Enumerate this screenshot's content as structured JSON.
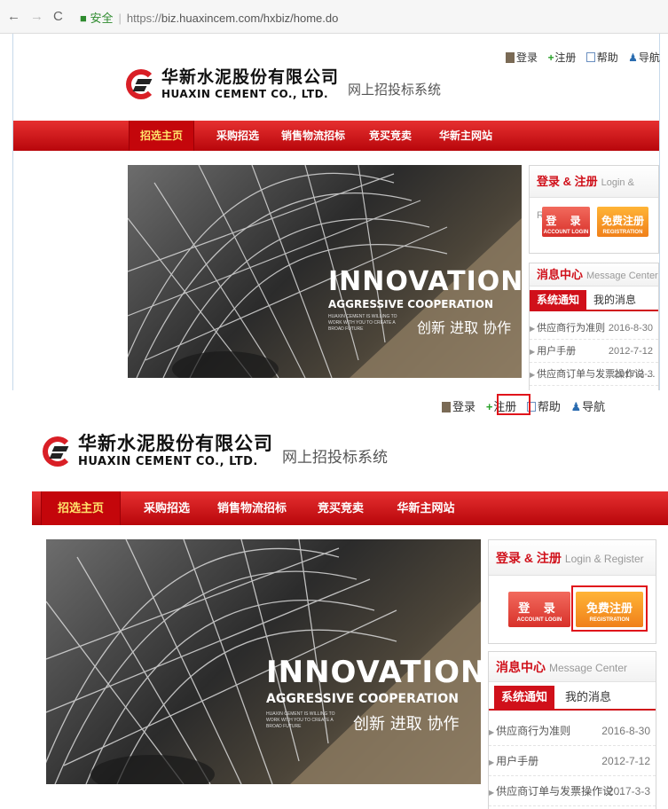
{
  "browser": {
    "back": "←",
    "forward": "→",
    "reload": "C",
    "secure_label": "安全",
    "url_scheme": "https://",
    "url_rest": "biz.huaxincem.com/hxbiz/home.do"
  },
  "header": {
    "utility": {
      "login": "登录",
      "register": "注册",
      "help": "帮助",
      "nav": "导航"
    },
    "logo_cn": "华新水泥股份有限公司",
    "logo_en": "HUAXIN CEMENT CO., LTD.",
    "system_name": "网上招投标系统"
  },
  "nav": {
    "items": [
      "招选主页",
      "采购招选",
      "销售物流招标",
      "竞买竞卖",
      "华新主网站"
    ]
  },
  "banner": {
    "title": "INNOVATION",
    "subtitle": "AGGRESSIVE COOPERATION",
    "small_text": "HUAXIN CEMENT IS WILLING TO\nWORK WITH YOU TO CREATE A\nBROAD FUTURE",
    "slogan_cn": "创新 进取 协作"
  },
  "login_box": {
    "title_cn": "登录 & 注册",
    "title_en": "Login & Register",
    "login_label": "登 录",
    "login_sub": "ACCOUNT LOGIN",
    "register_label": "免费注册",
    "register_sub": "REGISTRATION"
  },
  "message_center": {
    "title_cn": "消息中心",
    "title_en": "Message Center",
    "tabs": [
      "系统通知",
      "我的消息"
    ],
    "items": [
      {
        "title": "供应商行为准则",
        "date": "2016-8-30"
      },
      {
        "title": "用户手册",
        "date": "2012-7-12"
      },
      {
        "title": "供应商订单与发票操作说 ...",
        "date": "2017-3-3"
      }
    ]
  }
}
